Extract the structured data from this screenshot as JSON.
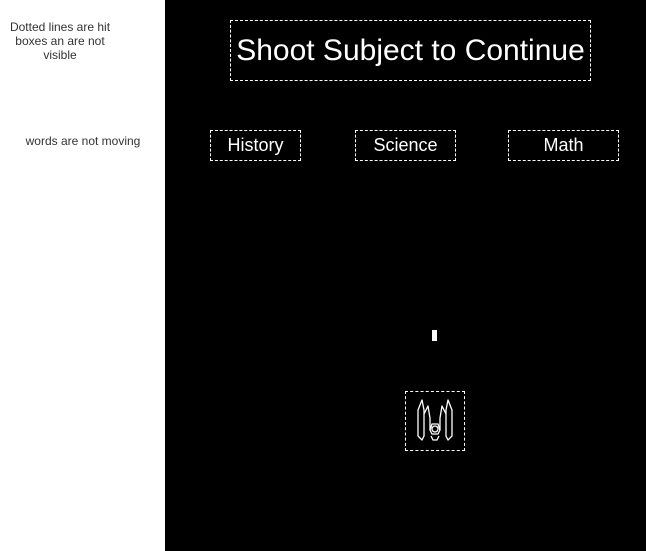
{
  "notes": {
    "hitbox_note": "Dotted lines are hit boxes an are not visible",
    "moving_note": "words are not moving"
  },
  "game": {
    "title": "Shoot Subject to Continue",
    "subjects": [
      {
        "label": "History"
      },
      {
        "label": "Science"
      },
      {
        "label": "Math"
      }
    ],
    "player": {
      "icon": "spaceship-icon"
    },
    "projectile": {
      "icon": "bullet"
    }
  },
  "colors": {
    "game_background": "#000000",
    "game_foreground": "#ffffff",
    "notes_text": "#333333",
    "page_background": "#ffffff"
  }
}
